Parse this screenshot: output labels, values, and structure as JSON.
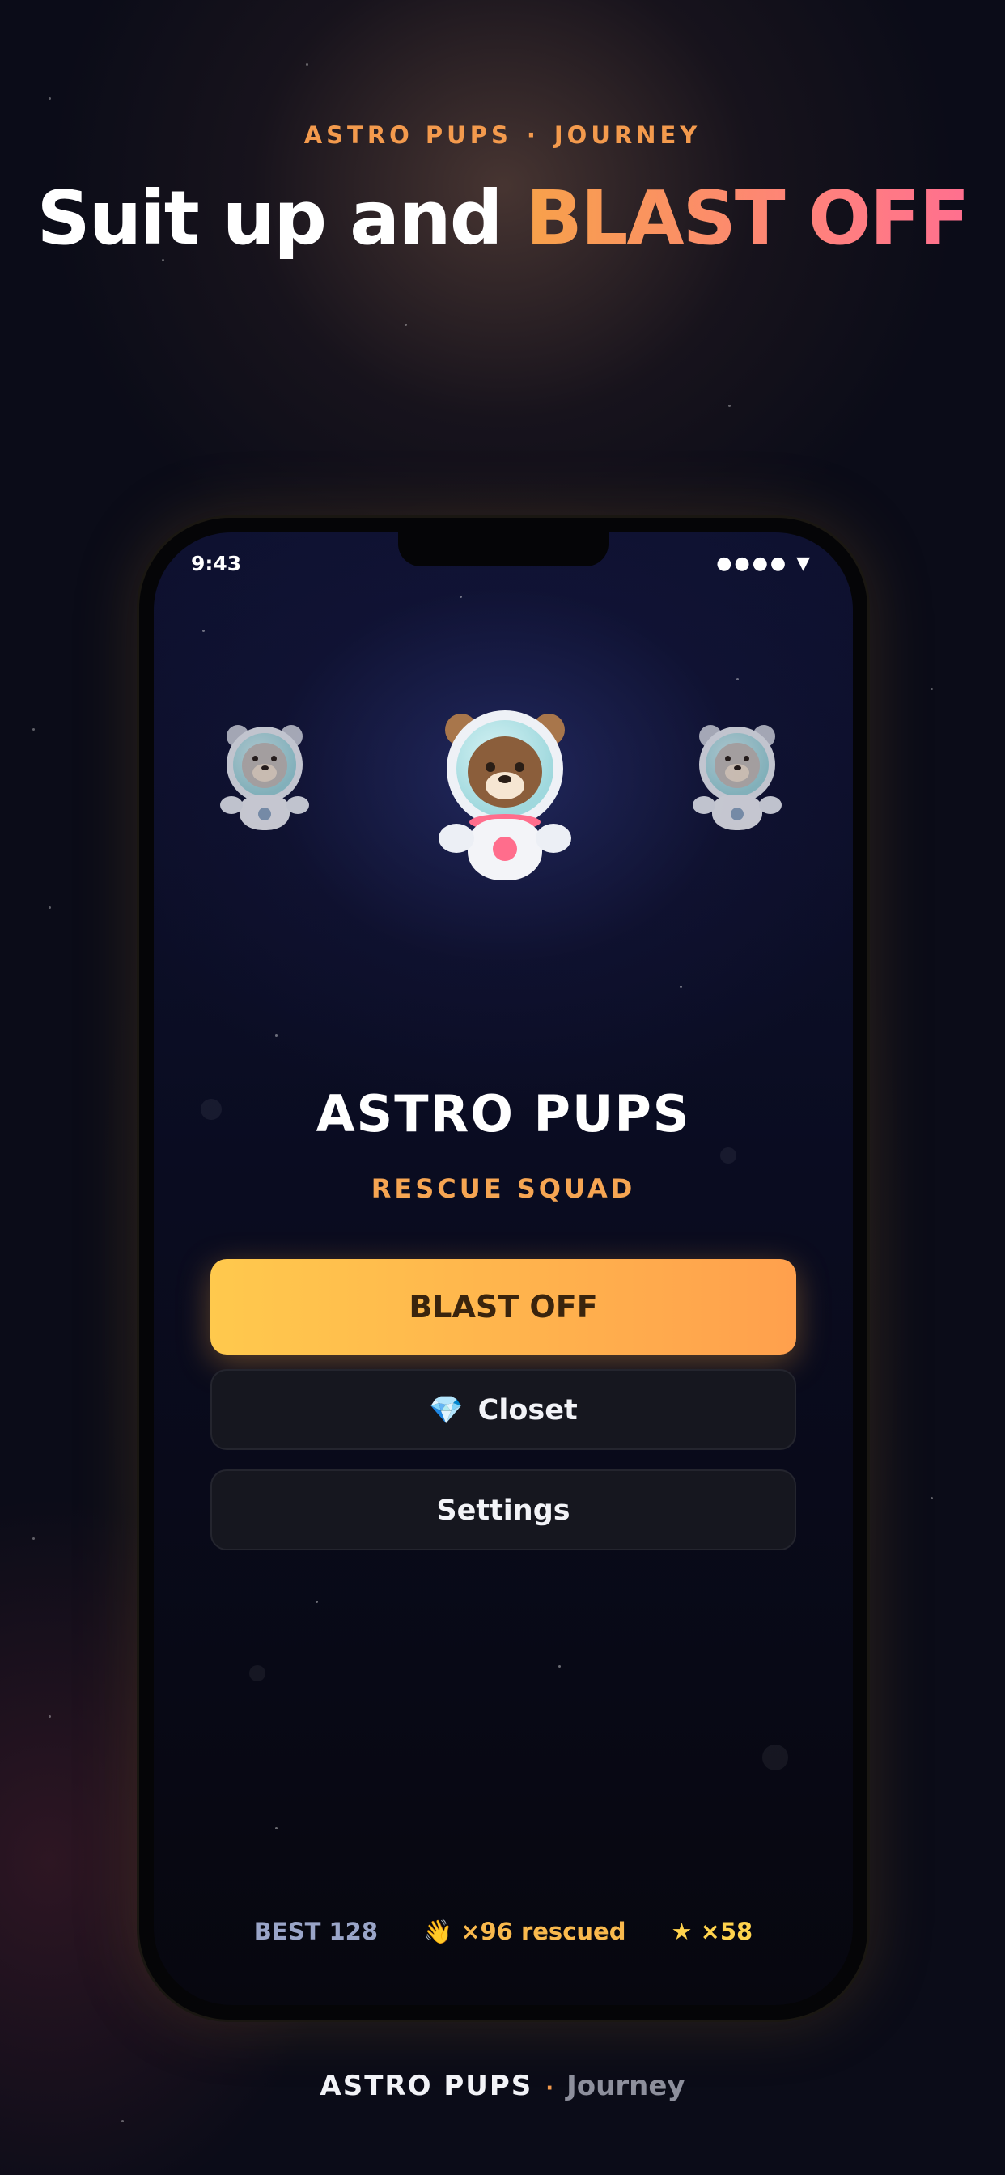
{
  "header": {
    "kicker_brand": "ASTRO PUPS",
    "kicker_separator": "·",
    "kicker_page": "JOURNEY",
    "headline_plain": "Suit up and ",
    "headline_accent": "BLAST OFF"
  },
  "status_bar": {
    "time": "9:43",
    "icons": "●●●● ▼"
  },
  "app": {
    "title": "ASTRO PUPS",
    "subtitle": "RESCUE SQUAD",
    "buttons": {
      "primary": "BLAST OFF",
      "closet_icon": "💎",
      "closet": "Closet",
      "settings": "Settings"
    },
    "stats": {
      "best": "BEST 128",
      "rescued": "👋 ×96 rescued",
      "stars": "★ ×58"
    }
  },
  "footer": {
    "brand": "ASTRO PUPS",
    "separator": "·",
    "page": "Journey"
  },
  "colors": {
    "accent_orange": "#f39a4d",
    "accent_pink": "#ff7f7f",
    "primary_button": "#ffb24d",
    "background": "#0b0c18"
  }
}
